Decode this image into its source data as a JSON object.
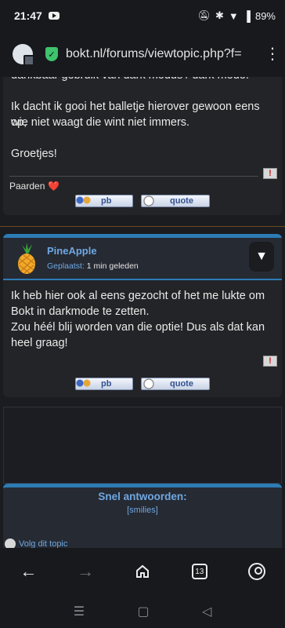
{
  "status": {
    "time": "21:47",
    "battery": "89%"
  },
  "browser": {
    "url": "bokt.nl/forums/viewtopic.php?f="
  },
  "post1": {
    "lines": [
      "dankbaar gebruik van dark modus / dark mode.",
      "",
      "Ik dacht ik gooi het balletje hierover gewoon eens op,",
      "wie niet waagt die wint niet immers.",
      "",
      "Groetjes!"
    ],
    "signature": "Paarden",
    "signature_emoji": "❤️",
    "pb_label": "pb",
    "quote_label": "quote"
  },
  "post2": {
    "username": "PineApple",
    "posted_label": "Geplaatst:",
    "posted_time": "1 min geleden",
    "dropdown_glyph": "▼",
    "lines": [
      "Ik heb hier ook al eens gezocht of het me lukte om",
      "Bokt in darkmode te zetten.",
      "Zou héél blij worden van die optie! Dus als dat kan",
      "heel graag!"
    ],
    "pb_label": "pb",
    "quote_label": "quote"
  },
  "reply": {
    "title": "Snel antwoorden:",
    "smilies": "[smilies]"
  },
  "follow": {
    "label": "Volg dit topic"
  },
  "nav": {
    "tabs": "13"
  },
  "icons": {
    "back": "arrow-left-icon",
    "forward": "arrow-right-icon",
    "home": "home-icon",
    "tabs": "tabs-icon",
    "profile": "profile-icon"
  },
  "colors": {
    "accent": "#2d7bb5",
    "link": "#6fa8e2",
    "report": "#cc1a1a"
  }
}
